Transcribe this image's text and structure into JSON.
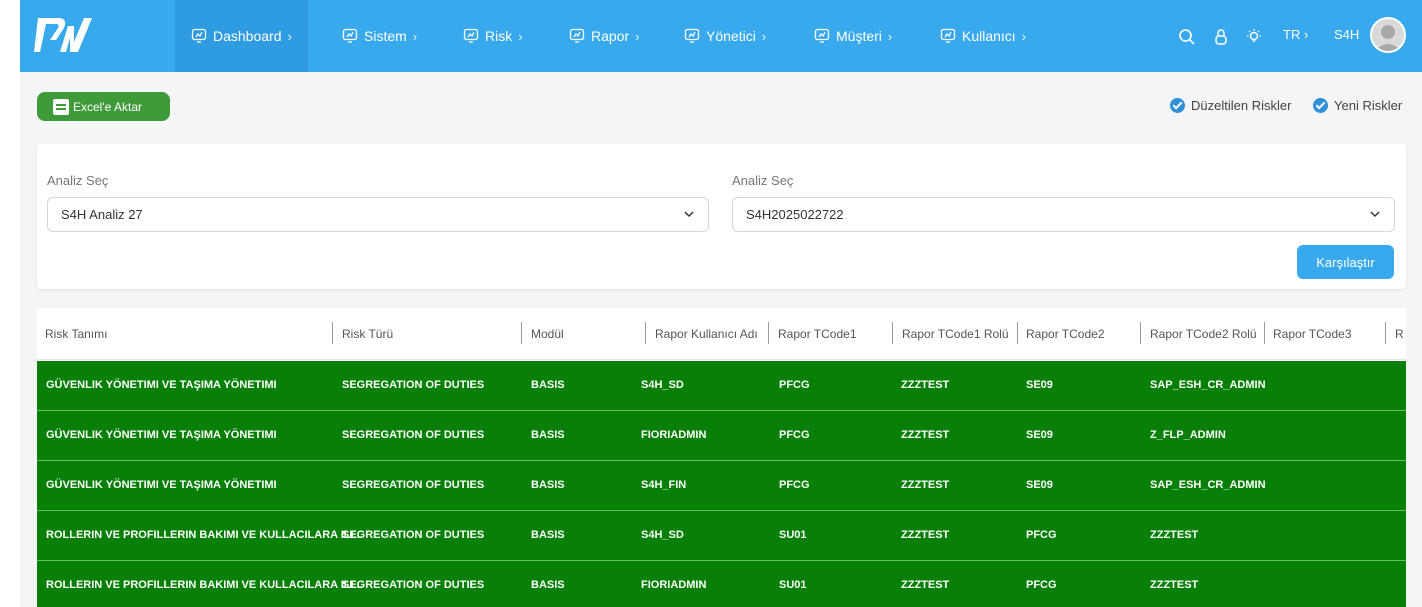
{
  "nav": {
    "items": [
      {
        "label": "Dashboard"
      },
      {
        "label": "Sistem"
      },
      {
        "label": "Risk"
      },
      {
        "label": "Rapor"
      },
      {
        "label": "Yönetici"
      },
      {
        "label": "Müşteri"
      },
      {
        "label": "Kullanıcı"
      }
    ],
    "lang": "TR ›",
    "user": "S4H"
  },
  "toolbar": {
    "excel_label": "Excel'e Aktar",
    "check_fixed": "Düzeltilen Riskler",
    "check_new": "Yeni Riskler"
  },
  "filters": {
    "left_label": "Analiz Seç",
    "left_value": "S4H Analiz 27",
    "right_label": "Analiz Seç",
    "right_value": "S4H2025022722",
    "compare_label": "Karşılaştır"
  },
  "table": {
    "headers": [
      "Risk Tanımı",
      "Risk Türü",
      "Modül",
      "Rapor Kullanıcı Adı",
      "Rapor TCode1",
      "Rapor TCode1 Rolü",
      "Rapor TCode2",
      "Rapor TCode2 Rolü",
      "Rapor TCode3",
      "R"
    ],
    "rows": [
      [
        "GÜVENLIK YÖNETIMI VE TAŞIMA YÖNETIMI",
        "SEGREGATION OF DUTIES",
        "BASIS",
        "S4H_SD",
        "PFCG",
        "ZZZTEST",
        "SE09",
        "SAP_ESH_CR_ADMIN",
        ""
      ],
      [
        "GÜVENLIK YÖNETIMI VE TAŞIMA YÖNETIMI",
        "SEGREGATION OF DUTIES",
        "BASIS",
        "FIORIADMIN",
        "PFCG",
        "ZZZTEST",
        "SE09",
        "Z_FLP_ADMIN",
        ""
      ],
      [
        "GÜVENLIK YÖNETIMI VE TAŞIMA YÖNETIMI",
        "SEGREGATION OF DUTIES",
        "BASIS",
        "S4H_FIN",
        "PFCG",
        "ZZZTEST",
        "SE09",
        "SAP_ESH_CR_ADMIN",
        ""
      ],
      [
        "ROLLERIN VE PROFILLERIN BAKIMI VE KULLACILARA ILI...",
        "SEGREGATION OF DUTIES",
        "BASIS",
        "S4H_SD",
        "SU01",
        "ZZZTEST",
        "PFCG",
        "ZZZTEST",
        ""
      ],
      [
        "ROLLERIN VE PROFILLERIN BAKIMI VE KULLACILARA ILI...",
        "SEGREGATION OF DUTIES",
        "BASIS",
        "FIORIADMIN",
        "SU01",
        "ZZZTEST",
        "PFCG",
        "ZZZTEST",
        ""
      ]
    ]
  },
  "colors": {
    "topbar": "#38a9ec",
    "row_bg": "#088008",
    "excel_button": "#3f9a3a",
    "check": "#2f8fd8"
  },
  "icons": [
    "logo-icon",
    "dashboard-icon",
    "chevron-right-icon",
    "search-icon",
    "lock-icon",
    "lightbulb-icon",
    "chevron-down-icon",
    "document-icon",
    "check-icon"
  ]
}
